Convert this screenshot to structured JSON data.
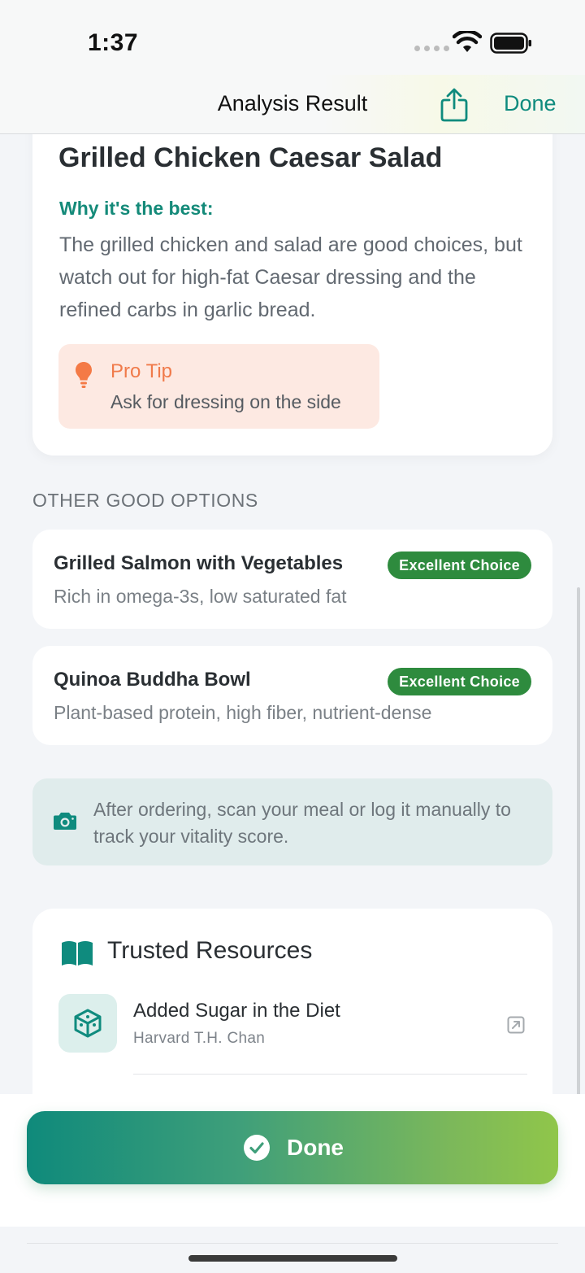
{
  "status_bar": {
    "time": "1:37"
  },
  "nav": {
    "title": "Analysis Result",
    "done_label": "Done"
  },
  "best_choice": {
    "title": "Grilled Chicken Caesar Salad",
    "why_label": "Why it's the best:",
    "why_text": "The grilled chicken and salad are good choices, but watch out for high-fat Caesar dressing and the refined carbs in garlic bread.",
    "pro_tip": {
      "title": "Pro Tip",
      "text": "Ask for dressing on the side"
    }
  },
  "other_options": {
    "header": "OTHER GOOD OPTIONS",
    "items": [
      {
        "name": "Grilled Salmon with Vegetables",
        "badge": "Excellent Choice",
        "description": "Rich in omega-3s, low saturated fat"
      },
      {
        "name": "Quinoa Buddha Bowl",
        "badge": "Excellent Choice",
        "description": "Plant-based protein, high fiber, nutrient-dense"
      }
    ]
  },
  "info_note": {
    "text": "After ordering, scan your meal or log it manually to track your vitality score.",
    "icon": "camera-icon"
  },
  "resources": {
    "title": "Trusted Resources",
    "icon": "book-icon",
    "items": [
      {
        "title": "Added Sugar in the Diet",
        "source": "Harvard T.H. Chan",
        "icon": "cube-icon"
      }
    ]
  },
  "bottom": {
    "done_label": "Done"
  },
  "colors": {
    "accent": "#0f8b7e",
    "badge_green": "#2e8b3e",
    "tip_orange": "#f07a4a",
    "tip_bg": "#fde9e2"
  }
}
